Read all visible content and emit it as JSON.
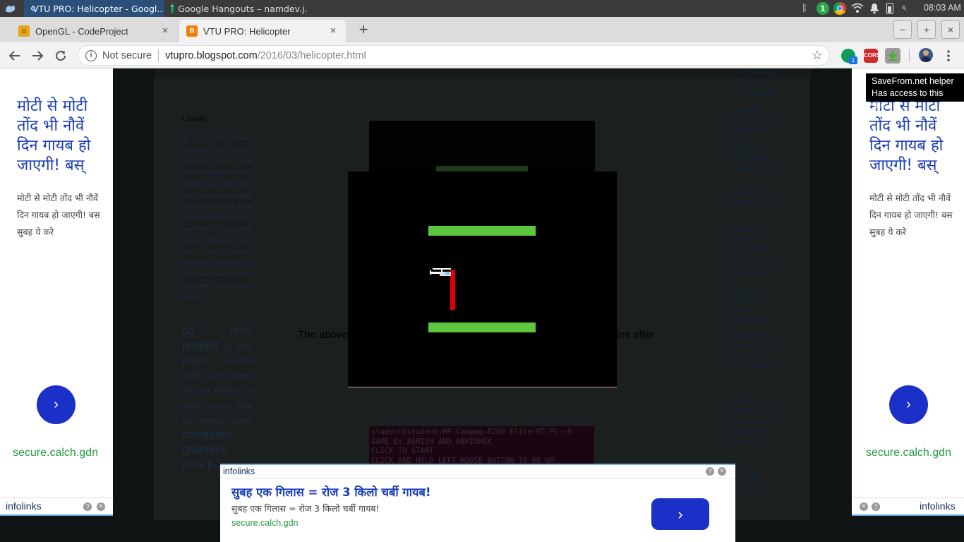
{
  "os_bar": {
    "tasks": [
      {
        "label": "VTU PRO: Helicopter - Googl...",
        "active": true
      },
      {
        "label": "Google Hangouts – namdev.j...",
        "active": false
      }
    ],
    "tray_badge": "1",
    "clock": "08:03 AM"
  },
  "browser": {
    "tabs": [
      {
        "label": "OpenGL - CodeProject",
        "active": false
      },
      {
        "label": "VTU PRO: Helicopter",
        "active": true
      }
    ],
    "new_tab": "+",
    "window_buttons": {
      "minimize": "−",
      "maximize": "+",
      "close": "×"
    },
    "security_label": "Not secure",
    "url_host": "vtupro.blogspot.com",
    "url_path": "/2016/03/helicopter.html",
    "extension_badge": "1",
    "cors_label": "CORS",
    "savefrom_tooltip": {
      "line1": "SaveFrom.net helper",
      "line2": "Has access to this site"
    }
  },
  "page": {
    "labels_heading": "Labels",
    "labels_text": "3d car 3d fan animated aeroplane cg project animated robot bank project animation aquarium aquarium cg project bank locker bank locker cg bank project book traveler game campus placement campus placement preparation campus preparation bps and bps campus placements car racing cg project car game cars racer cg cg game cg game mini project",
    "big_tags": [
      "cg mini project",
      "cg mini project source code",
      "cg mini project table",
      "cg project",
      "cg project source code",
      "cg source code",
      "computer graphics",
      "mini p..."
    ],
    "description_fragment_left": "The above",
    "description_fragment_right": "ucles after",
    "sidebar_links": [
      "Chronolo gical Resume",
      "Sample Functiona l Resume",
      "Sample Combinati on Resume",
      "Resume With Profile",
      "Sample Targeted Resume",
      "Sample Mini Resume",
      "Types of Nontraditi onal Resumes",
      "How To Prepare For Campus Placemen ts",
      "OpenGL Mini Project For CS/IS/IT Students With Ful...",
      "3D Car - Animation"
    ],
    "terminal_lines": [
      "student@student-HP-Compaq-8200-Elite-MT-PC:~$",
      "GAME BY ASHISH AND ABHISHEK",
      "CLICK TO START",
      "CLICK AND HOLD LEFT MOUSE BUTTON TO GO UP"
    ]
  },
  "side_ad": {
    "headline": "मोटी से मोटी तोंद भी नौवें दिन गायब हो जाएगी! बस्",
    "body": "मोटी से मोटी तोंद भी नौवें दिन गायब हो जाएगी! बस सुबह ये करे",
    "url": "secure.calch.gdn",
    "brand": "infolinks",
    "arrow": "›",
    "help": "?",
    "close": "×"
  },
  "bottom_ad": {
    "brand": "infolinks",
    "headline": "सुबह एक गिलास = रोज 3 किलो चर्बी गायब!",
    "body": "सुबह एक गिलास = रोज 3 किलो चर्बी गायब!",
    "url": "secure.calch.gdn",
    "arrow": "›",
    "help": "?",
    "close": "×"
  },
  "game": {
    "type": "helicopter",
    "colors": {
      "wall": "#5cc63c",
      "obstacle": "#e00000",
      "background": "#000000",
      "helicopter": "#ffffff"
    }
  }
}
